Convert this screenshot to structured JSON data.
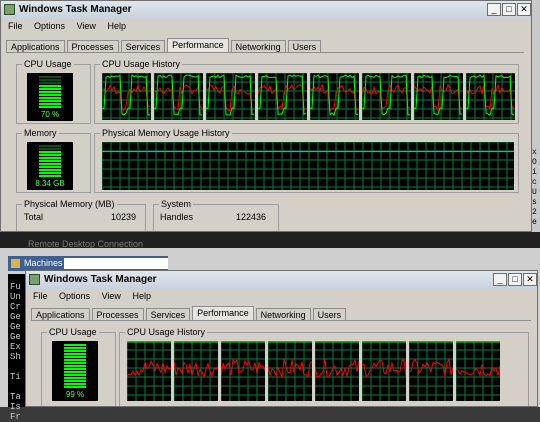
{
  "top_window": {
    "title": "Windows Task Manager",
    "menu": [
      "File",
      "Options",
      "View",
      "Help"
    ],
    "tabs": [
      "Applications",
      "Processes",
      "Services",
      "Performance",
      "Networking",
      "Users"
    ],
    "active_tab": "Performance",
    "cpu_usage": {
      "label": "CPU Usage",
      "value": "70 %",
      "fraction": 0.7
    },
    "cpu_history": {
      "label": "CPU Usage History",
      "panes": 8
    },
    "memory": {
      "label": "Memory",
      "value": "8.34 GB",
      "fraction": 0.82
    },
    "mem_history": {
      "label": "Physical Memory Usage History",
      "level": 0.8
    },
    "physical_memory": {
      "label": "Physical Memory (MB)",
      "total_label": "Total",
      "total_value": "10239"
    },
    "system": {
      "label": "System",
      "handles_label": "Handles",
      "handles_value": "122436"
    }
  },
  "side_console_chars": [
    "x",
    "O",
    "i",
    "c",
    "U",
    "s",
    "2",
    "e"
  ],
  "rdp": {
    "caption": "Remote Desktop Connection",
    "machines_label": "Machines"
  },
  "console_letters": [
    "Fu",
    "Un",
    "Cr",
    "Ge",
    "Ge",
    "Ge",
    "Ex",
    "Sh",
    "",
    "Ti",
    "",
    "Ta",
    "Is",
    "Fr"
  ],
  "bottom_window": {
    "title": "Windows Task Manager",
    "menu": [
      "File",
      "Options",
      "View",
      "Help"
    ],
    "tabs": [
      "Applications",
      "Processes",
      "Services",
      "Performance",
      "Networking",
      "Users"
    ],
    "active_tab": "Performance",
    "cpu_usage": {
      "label": "CPU Usage",
      "value": "99 %",
      "fraction": 0.99
    },
    "cpu_history": {
      "label": "CPU Usage History",
      "panes": 8
    }
  },
  "colors": {
    "graph_bg": "#000000",
    "grid": "#008040",
    "green": "#00ff00",
    "red": "#ff0000",
    "memory_line": "#4aa3ff"
  }
}
